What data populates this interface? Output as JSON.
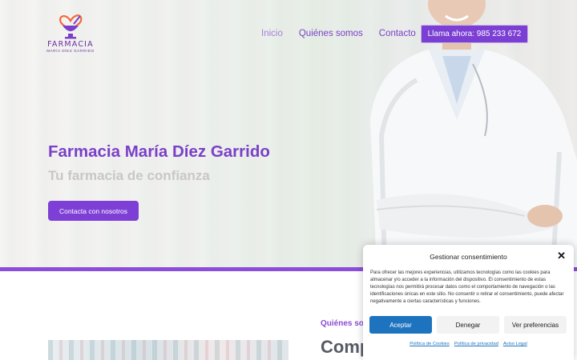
{
  "header": {
    "logo": {
      "name": "FARMACIA",
      "subtitle": "MARÍA DÍEZ GARRIDO",
      "icon": "pharmacy-heart-mortar-icon"
    },
    "nav": [
      {
        "label": "Inicio",
        "active": true
      },
      {
        "label": "Quiénes somos",
        "active": false
      },
      {
        "label": "Contacto",
        "active": false
      }
    ],
    "call_button": "Llama ahora: 985 233 672"
  },
  "hero": {
    "title": "Farmacia María Díez Garrido",
    "subtitle": "Tu farmacia de confianza",
    "cta": "Contacta con nosotros"
  },
  "about": {
    "tag": "Quiénes som",
    "title": "Comp"
  },
  "consent": {
    "title": "Gestionar consentimiento",
    "close_icon": "close-icon",
    "text": "Para ofrecer las mejores experiencias, utilizamos tecnologías como las cookies para almacenar y/o acceder a la información del dispositivo. El consentimiento de estas tecnologías nos permitirá procesar datos como el comportamiento de navegación o las identificaciones únicas en este sitio. No consentir o retirar el consentimiento, puede afectar negativamente a ciertas características y funciones.",
    "buttons": {
      "accept": "Aceptar",
      "deny": "Denegar",
      "prefs": "Ver preferencias"
    },
    "links": [
      "Política de Cookies",
      "Política de privacidad",
      "Aviso Legal"
    ]
  },
  "colors": {
    "brand_purple": "#7b3fc9",
    "accept_blue": "#1e73be",
    "divider": "#8c4ddb"
  }
}
